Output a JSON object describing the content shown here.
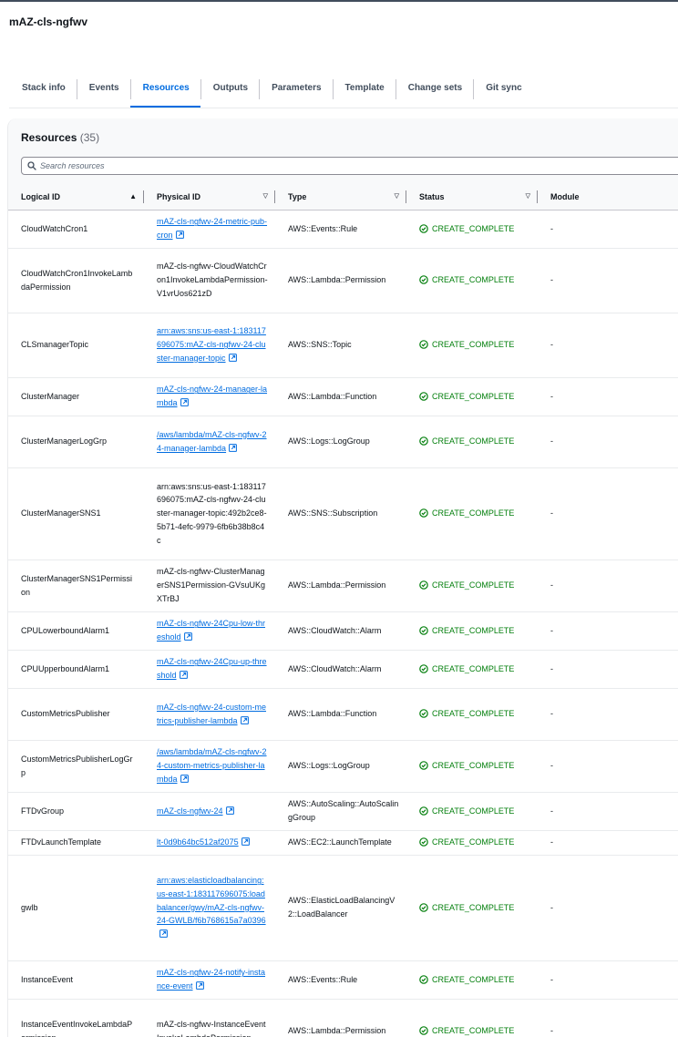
{
  "stack": {
    "title": "mAZ-cls-ngfwv"
  },
  "tabs": [
    {
      "label": "Stack info"
    },
    {
      "label": "Events"
    },
    {
      "label": "Resources"
    },
    {
      "label": "Outputs"
    },
    {
      "label": "Parameters"
    },
    {
      "label": "Template"
    },
    {
      "label": "Change sets"
    },
    {
      "label": "Git sync"
    }
  ],
  "active_tab": "Resources",
  "resources": {
    "title": "Resources",
    "count": "(35)",
    "search": {
      "placeholder": "Search resources",
      "value": ""
    },
    "columns": [
      "Logical ID",
      "Physical ID",
      "Type",
      "Status",
      "Module"
    ],
    "sorted_column": "Logical ID",
    "sort_direction": "ascending",
    "rows": [
      {
        "logical_id": "CloudWatchCron1",
        "physical_id": "mAZ-cls-ngfwv-24-metric-pub-cron",
        "physical_link": true,
        "type": "AWS::Events::Rule",
        "status": "CREATE_COMPLETE",
        "module": "-"
      },
      {
        "logical_id": "CloudWatchCron1InvokeLambdaPermission",
        "physical_id": "mAZ-cls-ngfwv-CloudWatchCron1InvokeLambdaPermission-V1vrUos621zD",
        "physical_link": false,
        "type": "AWS::Lambda::Permission",
        "status": "CREATE_COMPLETE",
        "module": "-"
      },
      {
        "logical_id": "CLSmanagerTopic",
        "physical_id": "arn:aws:sns:us-east-1:183117696075:mAZ-cls-ngfwv-24-cluster-manager-topic",
        "physical_link": true,
        "type": "AWS::SNS::Topic",
        "status": "CREATE_COMPLETE",
        "module": "-"
      },
      {
        "logical_id": "ClusterManager",
        "physical_id": "mAZ-cls-ngfwv-24-manager-lambda",
        "physical_link": true,
        "type": "AWS::Lambda::Function",
        "status": "CREATE_COMPLETE",
        "module": "-"
      },
      {
        "logical_id": "ClusterManagerLogGrp",
        "physical_id": "/aws/lambda/mAZ-cls-ngfwv-24-manager-lambda",
        "physical_link": true,
        "type": "AWS::Logs::LogGroup",
        "status": "CREATE_COMPLETE",
        "module": "-"
      },
      {
        "logical_id": "ClusterManagerSNS1",
        "physical_id": "arn:aws:sns:us-east-1:183117696075:mAZ-cls-ngfwv-24-cluster-manager-topic:492b2ce8-5b71-4efc-9979-6fb6b38b8c4c",
        "physical_link": false,
        "type": "AWS::SNS::Subscription",
        "status": "CREATE_COMPLETE",
        "module": "-"
      },
      {
        "logical_id": "ClusterManagerSNS1Permission",
        "physical_id": "mAZ-cls-ngfwv-ClusterManagerSNS1Permission-GVsuUKgXTrBJ",
        "physical_link": false,
        "type": "AWS::Lambda::Permission",
        "status": "CREATE_COMPLETE",
        "module": "-"
      },
      {
        "logical_id": "CPULowerboundAlarm1",
        "physical_id": "mAZ-cls-ngfwv-24Cpu-low-threshold",
        "physical_link": true,
        "type": "AWS::CloudWatch::Alarm",
        "status": "CREATE_COMPLETE",
        "module": "-"
      },
      {
        "logical_id": "CPUUpperboundAlarm1",
        "physical_id": "mAZ-cls-ngfwv-24Cpu-up-threshold",
        "physical_link": true,
        "type": "AWS::CloudWatch::Alarm",
        "status": "CREATE_COMPLETE",
        "module": "-"
      },
      {
        "logical_id": "CustomMetricsPublisher",
        "physical_id": "mAZ-cls-ngfwv-24-custom-metrics-publisher-lambda",
        "physical_link": true,
        "type": "AWS::Lambda::Function",
        "status": "CREATE_COMPLETE",
        "module": "-"
      },
      {
        "logical_id": "CustomMetricsPublisherLogGrp",
        "physical_id": "/aws/lambda/mAZ-cls-ngfwv-24-custom-metrics-publisher-lambda",
        "physical_link": true,
        "type": "AWS::Logs::LogGroup",
        "status": "CREATE_COMPLETE",
        "module": "-"
      },
      {
        "logical_id": "FTDvGroup",
        "physical_id": "mAZ-cls-ngfwv-24",
        "physical_link": true,
        "type": "AWS::AutoScaling::AutoScalingGroup",
        "status": "CREATE_COMPLETE",
        "module": "-"
      },
      {
        "logical_id": "FTDvLaunchTemplate",
        "physical_id": "lt-0d9b64bc512af2075",
        "physical_link": true,
        "type": "AWS::EC2::LaunchTemplate",
        "status": "CREATE_COMPLETE",
        "module": "-"
      },
      {
        "logical_id": "gwlb",
        "physical_id": "arn:aws:elasticloadbalancing:us-east-1:183117696075:loadbalancer/gwy/mAZ-cls-ngfwv-24-GWLB/f6b768615a7a0396",
        "physical_link": true,
        "type": "AWS::ElasticLoadBalancingV2::LoadBalancer",
        "status": "CREATE_COMPLETE",
        "module": "-"
      },
      {
        "logical_id": "InstanceEvent",
        "physical_id": "mAZ-cls-ngfwv-24-notify-instance-event",
        "physical_link": true,
        "type": "AWS::Events::Rule",
        "status": "CREATE_COMPLETE",
        "module": "-"
      },
      {
        "logical_id": "InstanceEventInvokeLambdaPermission",
        "physical_id": "mAZ-cls-ngfwv-InstanceEventInvokeLambdaPermission-",
        "physical_link": false,
        "type": "AWS::Lambda::Permission",
        "status": "CREATE_COMPLETE",
        "module": "-"
      }
    ]
  },
  "colors": {
    "link": "#006ce0",
    "success": "#037f0c",
    "active_tab": "#006ce0"
  },
  "icons": {
    "search": "search-icon",
    "external_link": "external-link-icon",
    "status_success": "status-success-icon",
    "sort_ascending": "sort-ascending-icon",
    "sort_unsorted": "sort-unsorted-icon"
  }
}
